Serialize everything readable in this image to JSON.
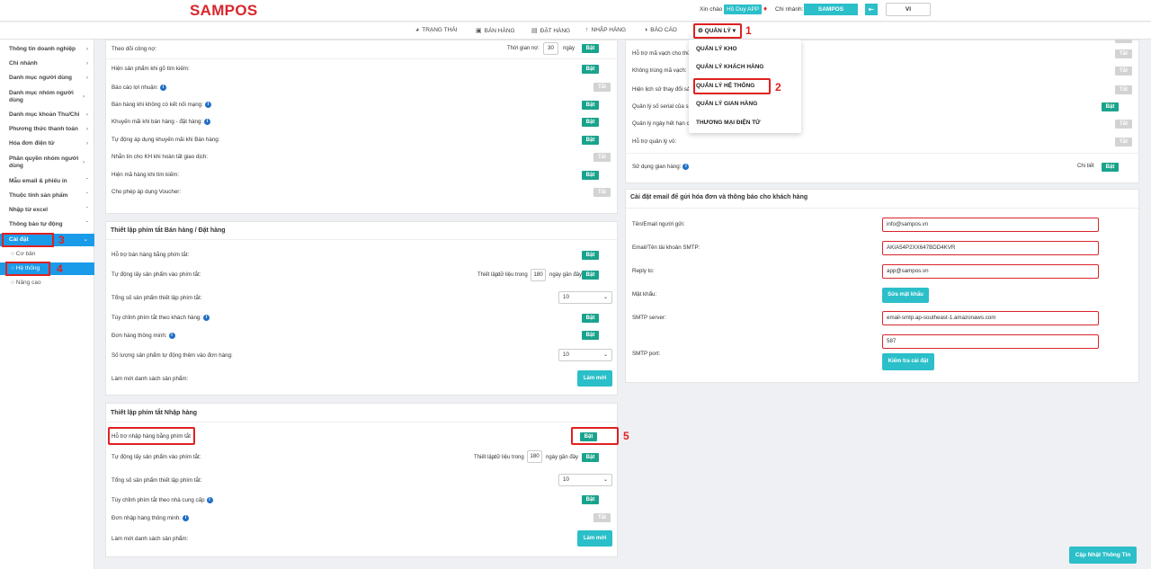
{
  "header": {
    "logo": "SAMPOS",
    "greeting": "Xin chào",
    "user": "Hồ Duy APP",
    "branch_label": "Chi nhánh:",
    "branch": "SAMPOS",
    "lang": "VI"
  },
  "nav": {
    "items": [
      "TRẠNG THÁI",
      "BÁN HÀNG",
      "ĐẶT HÀNG",
      "NHẬP HÀNG",
      "BÁO CÁO"
    ],
    "quanly": "QUẢN LÝ"
  },
  "dropdown": [
    "QUẢN LÝ KHO",
    "QUẢN LÝ KHÁCH HÀNG",
    "QUẢN LÝ HỆ THỐNG",
    "QUẢN LÝ GIAN HÀNG",
    "THƯƠNG MẠI ĐIỆN TỬ"
  ],
  "markers": [
    "1",
    "2",
    "3",
    "4",
    "5"
  ],
  "sidebar": {
    "items": [
      "Thông tin doanh nghiệp",
      "Chi nhánh",
      "Danh mục người dùng",
      "Danh mục nhóm người dùng",
      "Danh mục khoản Thu/Chi",
      "Phương thức thanh toán",
      "Hóa đơn điện tử",
      "Phân quyền nhóm người dùng",
      "Mẫu email & phiếu in",
      "Thuộc tính sản phẩm",
      "Nhập từ excel",
      "Thông báo tự động",
      "Cài đặt"
    ],
    "subs": [
      "Cơ bản",
      "Hệ thống",
      "Nâng cao"
    ]
  },
  "toggle": {
    "on": "Bật",
    "off": "Tắt"
  },
  "general": {
    "rows": [
      "Theo dõi công nợ:",
      "Hiện sản phẩm khi gõ tìm kiếm:",
      "Báo cáo lợi nhuận:",
      "Bán hàng khi không có kết nối mạng:",
      "Khuyến mãi khi bán hàng - đặt hàng:",
      "Tự động áp dụng khuyến mãi khi Bán hàng:",
      "Nhắn tin cho KH khi hoàn tất giao dịch:",
      "Hiện mã hàng khi tìm kiếm:",
      "Cho phép áp dụng Voucher:"
    ],
    "debt_time_label": "Thời gian nợ:",
    "debt_time_value": "30",
    "debt_time_unit": "ngày"
  },
  "sales_shortcut": {
    "title": "Thiết lập phím tắt Bán hàng / Đặt hàng",
    "rows": [
      "Hỗ trợ bán hàng bằng phím tắt:",
      "Tự động lấy sản phẩm vào phím tắt:",
      "Tổng số sản phẩm thiết lập phím tắt:",
      "Tùy chỉnh phím tắt theo khách hàng:",
      "Đơn hàng thông minh:",
      "Số lượng sản phẩm tự động thêm vào đơn hàng:",
      "Làm mới danh sách sản phẩm:"
    ],
    "setup_link": "Thiết lập",
    "data_in": "dữ liệu trong",
    "days_value": "180",
    "days_recent": "ngày gần đây",
    "select1": "10",
    "select2": "10",
    "refresh": "Làm mới"
  },
  "import_shortcut": {
    "title": "Thiết lập phím tắt Nhập hàng",
    "rows": [
      "Hỗ trợ nhập hàng bằng phím tắt",
      "Tự động lấy sản phẩm vào phím tắt:",
      "Tổng số sản phẩm thiết lập phím tắt:",
      "Tùy chỉnh phím tắt theo nhà cung cấp",
      "Đơn nhập hàng thông minh:",
      "Làm mới danh sách sản phẩm:"
    ],
    "setup_link": "Thiết lập",
    "data_in": "dữ liệu trong",
    "days_value": "180",
    "days_recent": "ngày gần đây",
    "select1": "10",
    "refresh": "Làm mới"
  },
  "right_top": {
    "rows": [
      "Hỗ trợ mã vạch cho thù",
      "Không trùng mã vạch:",
      "Hiện lịch sử thay đổi sả",
      "Quản lý số serial của sả",
      "Quản lý ngày hết hạn cí",
      "Hỗ trợ quản lý vỏ:",
      "Sử dụng gian hàng:"
    ],
    "detail": "Chi tiết"
  },
  "email": {
    "title": "Cài đặt email để gửi hóa đơn và thông báo cho khách hàng",
    "labels": [
      "Tên/Email người gửi:",
      "Email/Tên tài khoản SMTP:",
      "Reply to:",
      "Mật khẩu:",
      "SMTP server:",
      "SMTP port:"
    ],
    "sender": "info@sampos.vn",
    "smtp_user": "AKIA54P2XX647BDD4KVR",
    "reply_to": "app@sampos.vn",
    "edit_password": "Sửa mật khẩu",
    "server": "email-smtp.ap-southeast-1.amazonaws.com",
    "port": "587",
    "test_btn": "Kiểm tra cài đặt"
  },
  "update_btn": "Cập Nhật Thông Tin"
}
